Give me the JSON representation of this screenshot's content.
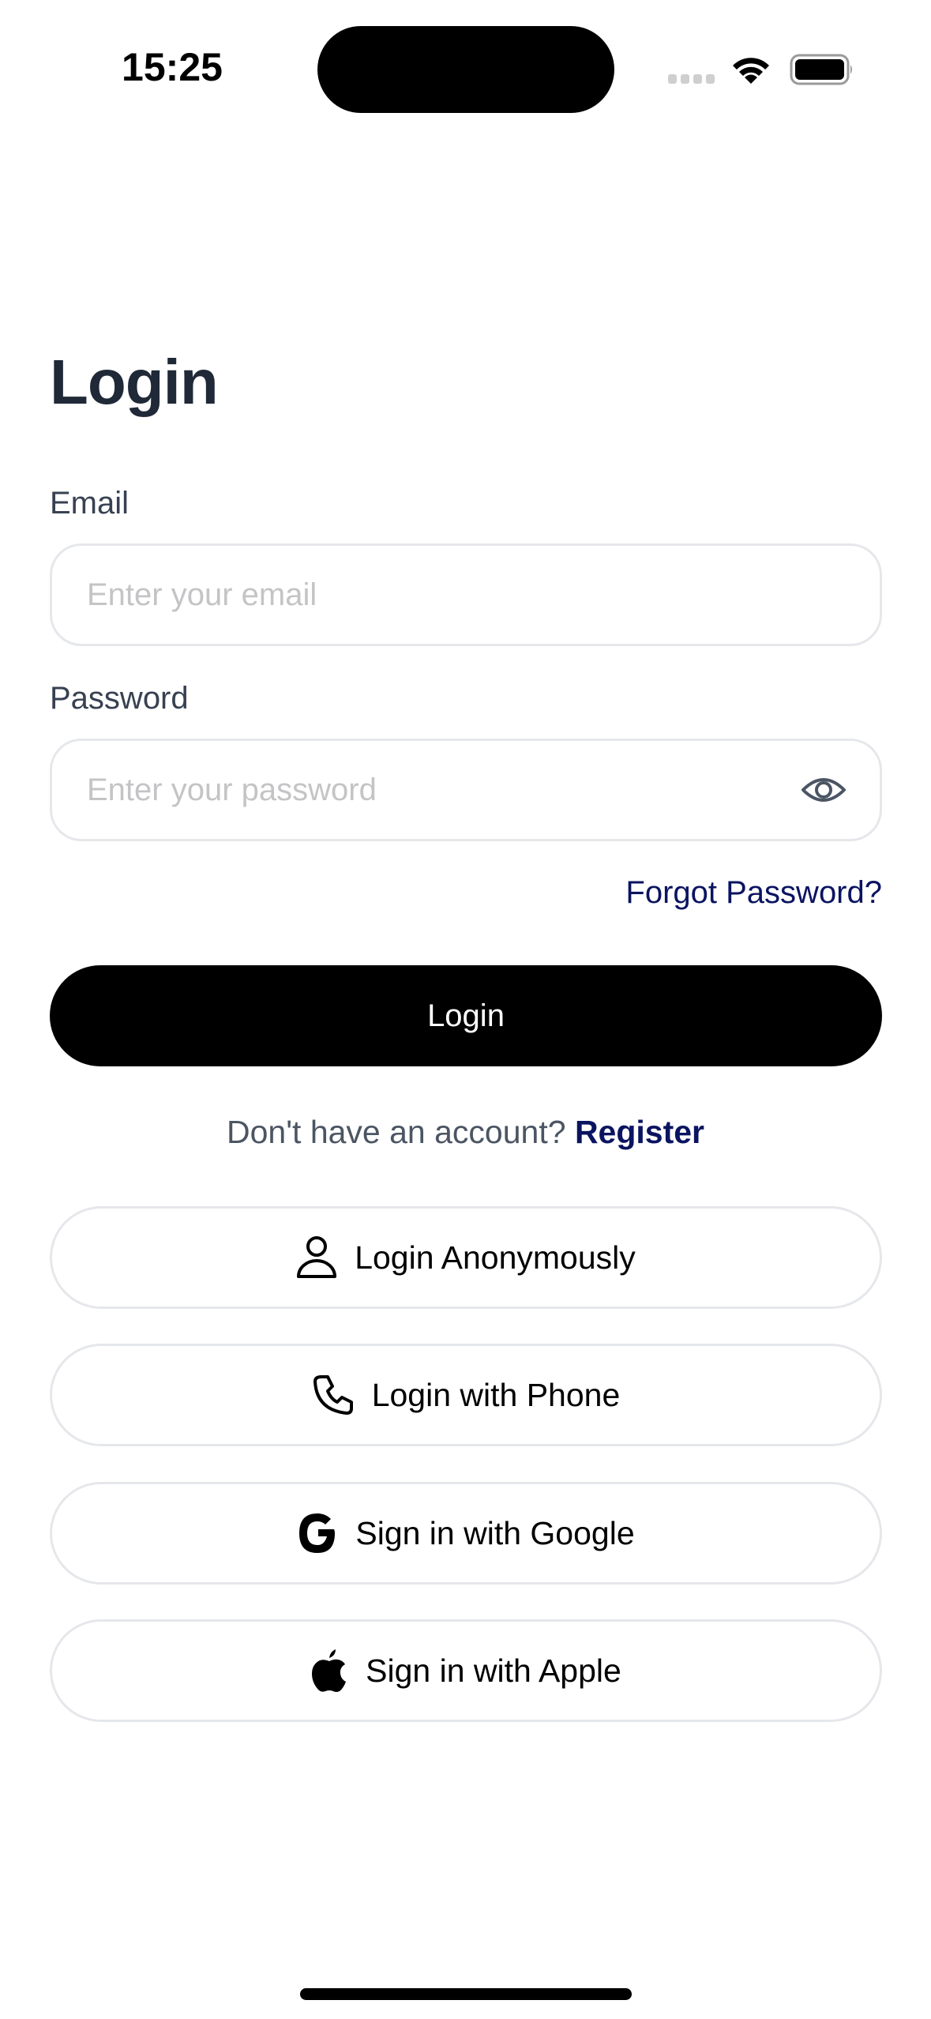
{
  "status_bar": {
    "time": "15:25",
    "icons": [
      "cellular-signal-icon",
      "wifi-icon",
      "battery-icon"
    ]
  },
  "login_form": {
    "title": "Login",
    "email": {
      "label": "Email",
      "value": "",
      "placeholder": "Enter your email"
    },
    "password": {
      "label": "Password",
      "value": "",
      "placeholder": "Enter your password",
      "toggle_icon": "eye-icon"
    },
    "forgot_password_label": "Forgot Password?",
    "submit_label": "Login",
    "register_prompt": "Don't have an account?",
    "register_label": "Register"
  },
  "alternative_logins": [
    {
      "label": "Login Anonymously",
      "icon": "user-icon"
    },
    {
      "label": "Login with Phone",
      "icon": "phone-icon"
    },
    {
      "label": "Sign in with Google",
      "icon": "google-icon"
    },
    {
      "label": "Sign in with Apple",
      "icon": "apple-icon"
    }
  ],
  "colors": {
    "title": "#1f2937",
    "label": "#374151",
    "link": "#0b1460",
    "primary_button": "#000000",
    "border": "#e5e7eb",
    "placeholder": "#c4c4c6"
  }
}
